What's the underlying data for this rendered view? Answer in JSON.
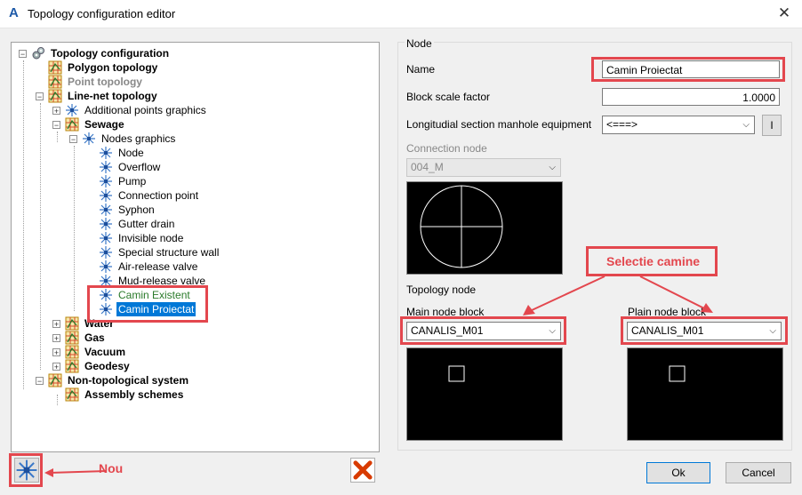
{
  "window": {
    "title": "Topology configuration editor"
  },
  "tree": {
    "root": "Topology configuration",
    "polygon": "Polygon topology",
    "point": "Point topology",
    "linenet": "Line-net topology",
    "additional": "Additional points graphics",
    "sewage": "Sewage",
    "nodes_graphics": "Nodes graphics",
    "nodes": [
      "Node",
      "Overflow",
      "Pump",
      "Connection point",
      "Syphon",
      "Gutter drain",
      "Invisible node",
      "Special structure wall",
      "Air-release valve",
      "Mud-release valve",
      "Camin Existent",
      "Camin Proiectat"
    ],
    "water": "Water",
    "gas": "Gas",
    "vacuum": "Vacuum",
    "geodesy": "Geodesy",
    "nontopo": "Non-topological system",
    "assembly": "Assembly schemes"
  },
  "node": {
    "group_label": "Node",
    "name_label": "Name",
    "name_value": "Camin Proiectat",
    "scale_label": "Block scale factor",
    "scale_value": "1.0000",
    "longitudinal_label": "Longitudial section manhole equipment",
    "longitudinal_value": "<===>",
    "info_button": "I",
    "connection_label": "Connection node",
    "connection_value": "004_M",
    "topology_label": "Topology node",
    "main_block_label": "Main node block",
    "main_block_value": "CANALIS_M01",
    "plain_block_label": "Plain node block",
    "plain_block_value": "CANALIS_M01"
  },
  "buttons": {
    "ok": "Ok",
    "cancel": "Cancel"
  },
  "annotations": {
    "selectie": "Selectie camine",
    "nou": "Nou"
  },
  "colors": {
    "annotation_red": "#e3474e",
    "selection_blue": "#0078d7"
  }
}
